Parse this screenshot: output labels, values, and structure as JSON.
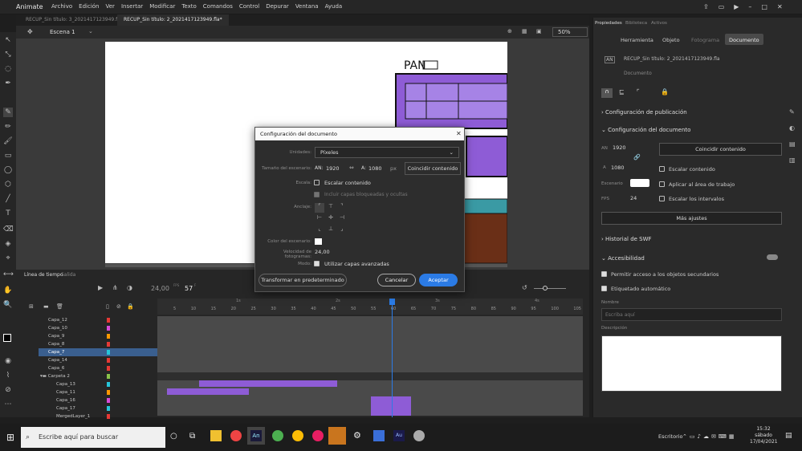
{
  "app": {
    "name": "Animate",
    "menu": [
      "Archivo",
      "Edición",
      "Ver",
      "Insertar",
      "Modificar",
      "Texto",
      "Comandos",
      "Control",
      "Depurar",
      "Ventana",
      "Ayuda"
    ]
  },
  "tabs": [
    {
      "label": "RECUP_Sin título: 3_2021417123949.fla"
    },
    {
      "label": "RECUP_Sin título: 2_2021417123949.fla*",
      "active": true
    }
  ],
  "scene": {
    "name": "Escena 1",
    "zoom": "50%"
  },
  "timeline": {
    "tabs": [
      "Línea de tiempo",
      "Salida"
    ],
    "fps": "24,00",
    "fps_unit": "FPS",
    "frame": "57",
    "frame_unit": "F",
    "ruler": [
      "5",
      "10",
      "15",
      "20",
      "25",
      "30",
      "35",
      "40",
      "45",
      "50",
      "55",
      "60",
      "65",
      "70",
      "75",
      "80",
      "85",
      "90",
      "95",
      "100",
      "105"
    ],
    "seconds": [
      "1s",
      "2s",
      "3s",
      "4s"
    ],
    "layers": [
      {
        "name": "Capa_12",
        "color": "#e53935"
      },
      {
        "name": "Capa_10",
        "color": "#d84bd8"
      },
      {
        "name": "Capa_9",
        "color": "#ff9800"
      },
      {
        "name": "Capa_8",
        "color": "#e53935"
      },
      {
        "name": "Capa_7",
        "color": "#26c6da",
        "selected": true
      },
      {
        "name": "Capa_14",
        "color": "#e53935"
      },
      {
        "name": "Capa_6",
        "color": "#e53935"
      },
      {
        "name": "Carpeta 2",
        "color": "#8bc34a",
        "folder": true
      },
      {
        "name": "Capa_13",
        "color": "#26c6da"
      },
      {
        "name": "Capa_11",
        "color": "#ff9800"
      },
      {
        "name": "Capa_16",
        "color": "#d84bd8"
      },
      {
        "name": "Capa_17",
        "color": "#26c6da"
      },
      {
        "name": "MergedLayer_1",
        "color": "#e53935"
      }
    ]
  },
  "panel": {
    "tabs": [
      "Propiedades",
      "Biblioteca",
      "Activos"
    ],
    "subtabs": [
      "Herramienta",
      "Objeto",
      "Fotograma",
      "Documento"
    ],
    "doc_name": "RECUP_Sin título: 2_2021417123949.fla",
    "doc_type": "Documento",
    "sections": {
      "publish": "Configuración de publicación",
      "doc": "Configuración del documento",
      "swf": "Historial de SWF",
      "access": "Accesibilidad"
    },
    "an_label": "AN",
    "an_value": "1920",
    "a_label": "A",
    "a_value": "1080",
    "match_btn": "Coincidir contenido",
    "scale_content": "Escalar contenido",
    "apply_workarea": "Aplicar al área de trabajo",
    "stage_label": "Escenario",
    "fps_label": "FPS",
    "fps_value": "24",
    "scale_intervals": "Escalar los intervalos",
    "more_settings": "Más ajustes",
    "access_child": "Permitir acceso a los objetos secundarios",
    "auto_label": "Etiquetado automático",
    "name_label": "Nombre",
    "name_placeholder": "Escriba aquí",
    "desc_label": "Descripción"
  },
  "dialog": {
    "title": "Configuración del documento",
    "units_label": "Unidades:",
    "units_value": "Píxeles",
    "size_label": "Tamaño del escenario:",
    "an_label": "AN:",
    "width": "1920",
    "a_label": "A:",
    "height": "1080",
    "px": "px",
    "match_btn": "Coincidir contenido",
    "scale_label": "Escala:",
    "scale_content": "Escalar contenido",
    "include_locked": "Incluir capas bloqueadas y ocultas",
    "anchor_label": "Anclaje:",
    "stage_color_label": "Color del escenario:",
    "framerate_label": "Velocidad de fotogramas:",
    "framerate": "24,00",
    "mode_label": "Modo:",
    "advanced_layers": "Utilizar capas avanzadas",
    "transform_btn": "Transformar en predeterminado",
    "cancel_btn": "Cancelar",
    "ok_btn": "Aceptar"
  },
  "canvas_text": {
    "sign": "PAN"
  },
  "taskbar": {
    "search": "Escribe aquí para buscar",
    "lang": "Escritorio",
    "time": "15:32",
    "day": "sábado",
    "date": "17/04/2021"
  },
  "colors": {
    "accent": "#2b7be5",
    "selection": "#3a5f8f",
    "purple": "#8e5cd6"
  }
}
